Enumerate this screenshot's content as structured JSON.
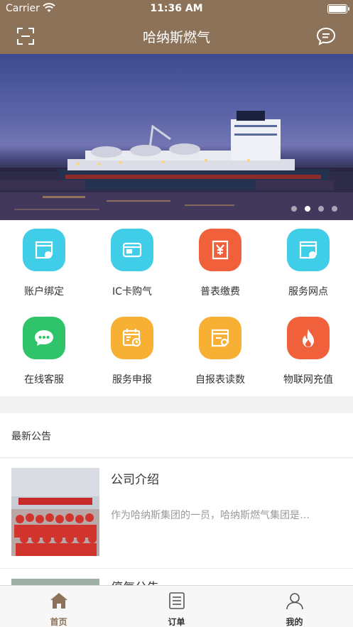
{
  "status": {
    "carrier": "Carrier",
    "time": "11:36 AM"
  },
  "nav": {
    "title": "哈纳斯燃气",
    "left_icon": "scan-icon",
    "right_icon": "message-icon"
  },
  "banner": {
    "slides": 4,
    "active_slide": 1
  },
  "services": [
    {
      "label": "账户绑定",
      "icon": "account-bind-icon",
      "color": "#3fcde8"
    },
    {
      "label": "IC卡购气",
      "icon": "ic-card-icon",
      "color": "#3fcde8"
    },
    {
      "label": "普表缴费",
      "icon": "yen-payment-icon",
      "color": "#f0603a"
    },
    {
      "label": "服务网点",
      "icon": "service-outlet-icon",
      "color": "#3fcde8"
    },
    {
      "label": "在线客服",
      "icon": "chat-bubble-icon",
      "color": "#2fc46a"
    },
    {
      "label": "服务申报",
      "icon": "calendar-icon",
      "color": "#f7b033"
    },
    {
      "label": "自报表读数",
      "icon": "meter-reading-icon",
      "color": "#f7b033"
    },
    {
      "label": "物联网充值",
      "icon": "flame-icon",
      "color": "#f0603a"
    }
  ],
  "announcements": {
    "heading": "最新公告",
    "items": [
      {
        "title": "公司介绍",
        "summary": "作为哈纳斯集团的一员，哈纳斯燃气集团是…"
      },
      {
        "title": "停气公告",
        "summary": ""
      }
    ]
  },
  "tabs": [
    {
      "label": "首页",
      "icon": "home-icon",
      "active": true
    },
    {
      "label": "订单",
      "icon": "order-list-icon",
      "active": false
    },
    {
      "label": "我的",
      "icon": "profile-icon",
      "active": false
    }
  ],
  "colors": {
    "brand": "#8c7258",
    "text": "#333333",
    "muted": "#9a9a9a"
  }
}
